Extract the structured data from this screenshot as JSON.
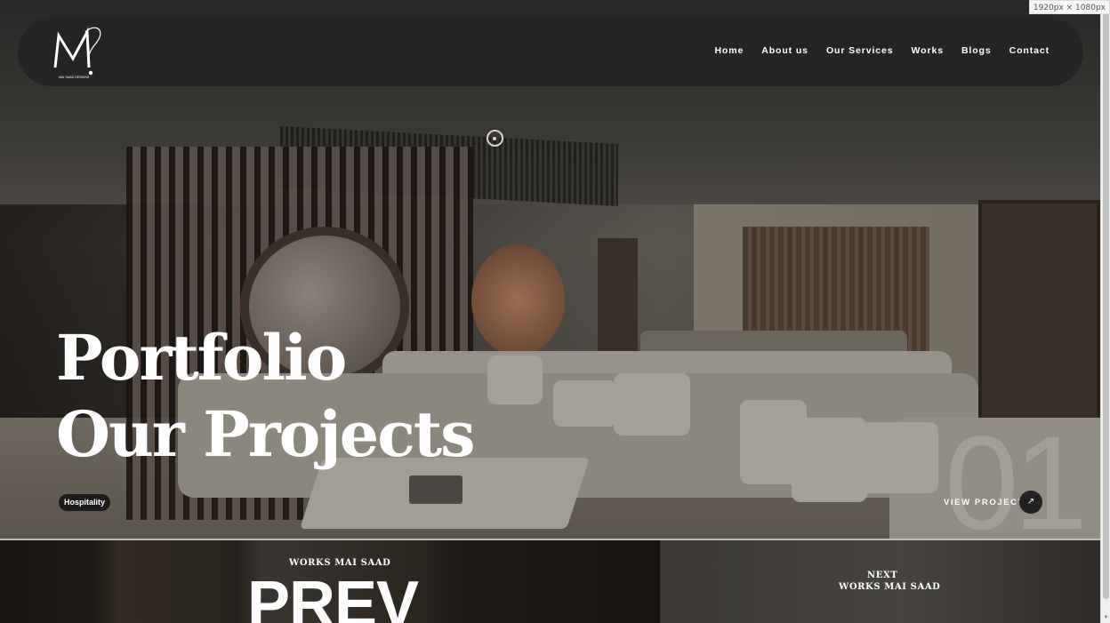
{
  "header": {
    "logo_letters": "M",
    "logo_caption": "MAI SAAD DESIGNS",
    "nav": [
      {
        "label": "Home"
      },
      {
        "label": "About us"
      },
      {
        "label": "Our Services"
      },
      {
        "label": "Works"
      },
      {
        "label": "Blogs"
      },
      {
        "label": "Contact"
      }
    ]
  },
  "hero": {
    "title_line1": "Portfolio",
    "title_line2": "Our Projects",
    "category_tag": "Hospitality",
    "project_number": "01",
    "view_project_label": "VIEW PROJECT",
    "view_project_icon": "arrow-up-right-icon"
  },
  "pager": {
    "prev_caption": "WORKS MAI SAAD",
    "prev_label": "PREV",
    "next_caption": "NEXT",
    "next_works": "WORKS MAI SAAD"
  },
  "viewport_badge": "1920px × 1080px",
  "colors": {
    "header_bg": "#262422",
    "text": "#ffffff",
    "tag_bg": "#1c1b1a"
  }
}
